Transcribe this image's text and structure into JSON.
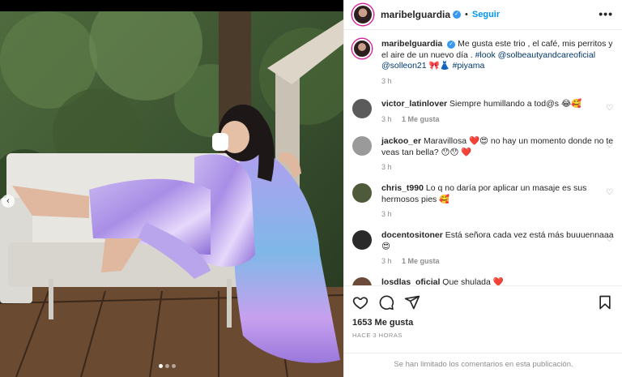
{
  "post": {
    "username": "maribelguardia",
    "follow_label": "Seguir",
    "separator": "•",
    "more_label": "•••"
  },
  "caption": {
    "username": "maribelguardia",
    "text": "Me gusta este trio , el café, mis perritos y el aire de un nuevo día .",
    "tag1": "#look",
    "mention1": "@solbeautyandcareoficial",
    "mention2": "@solleon21",
    "emoji": "🎀👗",
    "tag2": "#piyama",
    "time": "3 h"
  },
  "comments": [
    {
      "username": "victor_latinlover",
      "text": "Siempre humillando a tod@s 😂🥰",
      "time": "3 h",
      "likes": "1 Me gusta",
      "avatar_color": "#5b5b5b"
    },
    {
      "username": "jackoo_er",
      "text": "Maravillosa ❤️😍 no hay un momento donde no te veas tan bella? 😯😯 ❤️",
      "time": "3 h",
      "avatar_color": "#9a9a9a"
    },
    {
      "username": "chris_t990",
      "text": "Lo q no daría por aplicar un masaje es sus hermosos pies 🥰",
      "time": "3 h",
      "avatar_color": "#4e5a3a"
    },
    {
      "username": "docentositoner",
      "text": "Está señora cada vez está más buuuennaaa😍",
      "time": "3 h",
      "likes": "1 Me gusta",
      "avatar_color": "#2a2a2a"
    },
    {
      "username": "losdlas_oficial",
      "text": "Que shulada ❤️",
      "avatar_color": "#6b4a3a"
    }
  ],
  "actions": {
    "likes": "1653 Me gusta",
    "ago": "HACE 3 HORAS",
    "limited": "Se han limitado los comentarios en esta publicación."
  },
  "colors": {
    "link": "#00376b",
    "accent": "#0095f6",
    "muted": "#8e8e8e"
  },
  "icons": [
    "heart-icon",
    "comment-icon",
    "share-icon",
    "bookmark-icon",
    "more-icon",
    "chevron-left-icon",
    "verified-icon"
  ]
}
